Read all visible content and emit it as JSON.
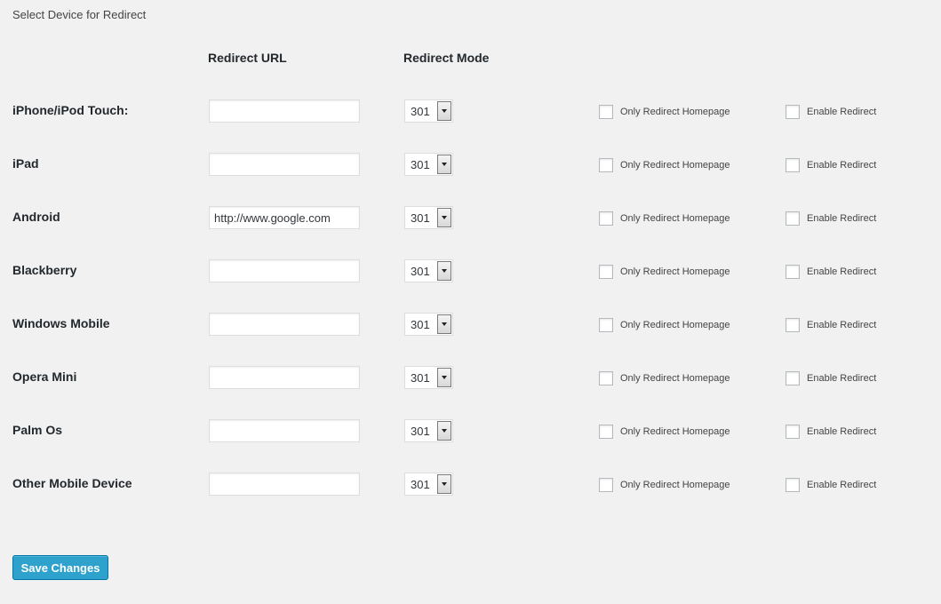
{
  "section_title": "Select Device for Redirect",
  "columns": {
    "url": "Redirect URL",
    "mode": "Redirect Mode"
  },
  "rows": [
    {
      "device": "iPhone/iPod Touch:",
      "url": "",
      "mode": "301",
      "only_home": "Only Redirect Homepage",
      "enable": "Enable Redirect"
    },
    {
      "device": "iPad",
      "url": "",
      "mode": "301",
      "only_home": "Only Redirect Homepage",
      "enable": "Enable Redirect"
    },
    {
      "device": "Android",
      "url": "http://www.google.com",
      "mode": "301",
      "only_home": "Only Redirect Homepage",
      "enable": "Enable Redirect"
    },
    {
      "device": "Blackberry",
      "url": "",
      "mode": "301",
      "only_home": "Only Redirect Homepage",
      "enable": "Enable Redirect"
    },
    {
      "device": "Windows Mobile",
      "url": "",
      "mode": "301",
      "only_home": "Only Redirect Homepage",
      "enable": "Enable Redirect"
    },
    {
      "device": "Opera Mini",
      "url": "",
      "mode": "301",
      "only_home": "Only Redirect Homepage",
      "enable": "Enable Redirect"
    },
    {
      "device": "Palm Os",
      "url": "",
      "mode": "301",
      "only_home": "Only Redirect Homepage",
      "enable": "Enable Redirect"
    },
    {
      "device": "Other Mobile Device",
      "url": "",
      "mode": "301",
      "only_home": "Only Redirect Homepage",
      "enable": "Enable Redirect"
    }
  ],
  "save_label": "Save Changes",
  "colors": {
    "background": "#f1f1f1",
    "primary_button": "#2ea2cc",
    "primary_button_border": "#0074a2"
  }
}
